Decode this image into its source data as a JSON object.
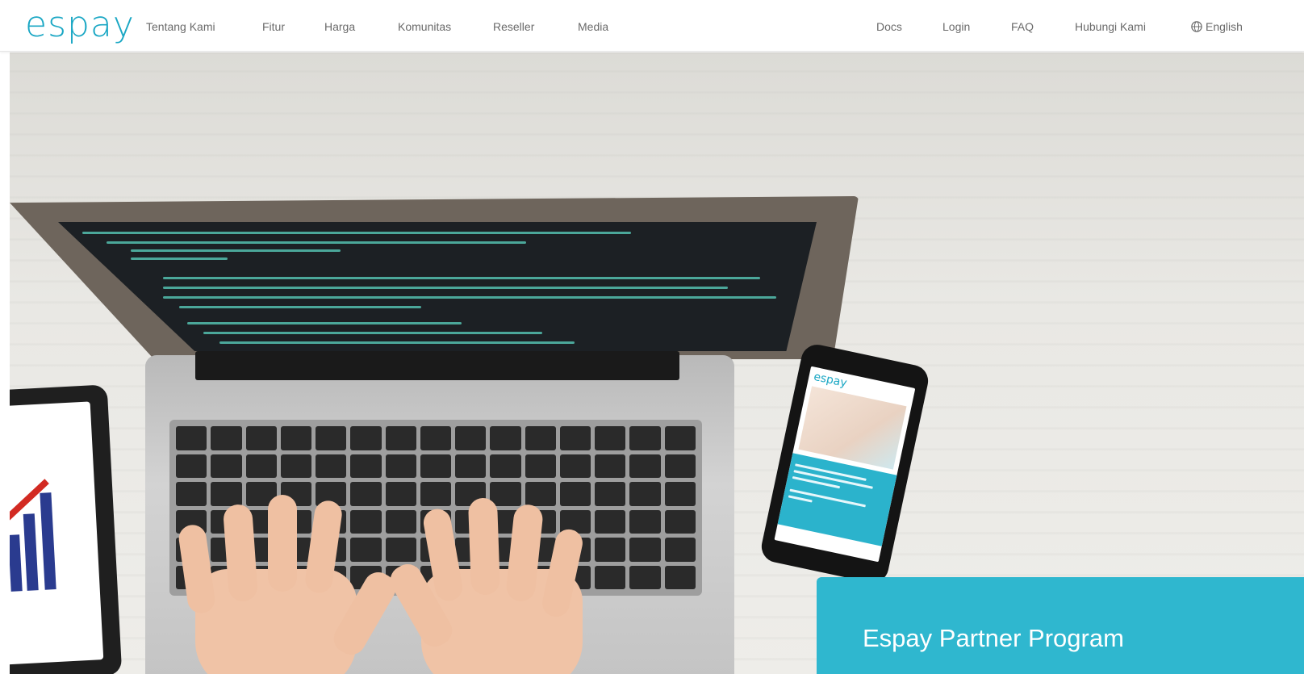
{
  "brand": {
    "logo_text": "espay",
    "primary_color": "#1aa7c4",
    "accent_color": "#2fb7cf"
  },
  "nav": {
    "left_items": [
      {
        "label": "Tentang Kami"
      },
      {
        "label": "Fitur"
      },
      {
        "label": "Harga"
      },
      {
        "label": "Komunitas"
      },
      {
        "label": "Reseller"
      },
      {
        "label": "Media"
      }
    ],
    "right_items": [
      {
        "label": "Docs"
      },
      {
        "label": "Login"
      },
      {
        "label": "FAQ"
      },
      {
        "label": "Hubungi Kami"
      },
      {
        "label": "English",
        "icon": "globe-icon"
      }
    ]
  },
  "hero": {
    "phone_logo": "espay",
    "cta_title": "Espay Partner Program"
  }
}
